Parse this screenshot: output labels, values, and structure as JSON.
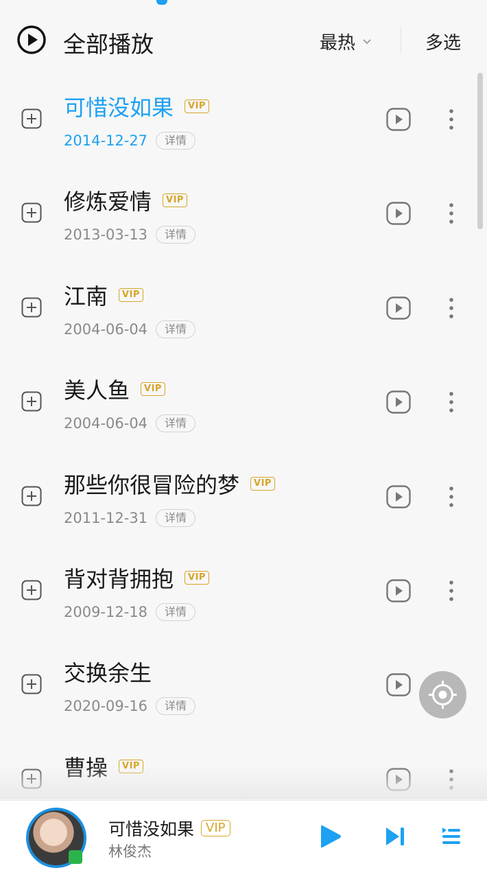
{
  "header": {
    "play_all_label": "全部播放",
    "sort_label": "最热",
    "multi_select_label": "多选"
  },
  "songs": [
    {
      "title": "可惜没如果",
      "vip": "VIP",
      "date": "2014-12-27",
      "detail": "详情",
      "active": true
    },
    {
      "title": "修炼爱情",
      "vip": "VIP",
      "date": "2013-03-13",
      "detail": "详情"
    },
    {
      "title": "江南",
      "vip": "VIP",
      "date": "2004-06-04",
      "detail": "详情"
    },
    {
      "title": "美人鱼",
      "vip": "VIP",
      "date": "2004-06-04",
      "detail": "详情"
    },
    {
      "title": "那些你很冒险的梦",
      "vip": "VIP",
      "date": "2011-12-31",
      "detail": "详情"
    },
    {
      "title": "背对背拥抱",
      "vip": "VIP",
      "date": "2009-12-18",
      "detail": "详情"
    },
    {
      "title": "交换余生",
      "vip": "",
      "date": "2020-09-16",
      "detail": "详情"
    },
    {
      "title": "曹操",
      "vip": "VIP",
      "date": "",
      "detail": ""
    }
  ],
  "player": {
    "title": "可惜没如果",
    "vip": "VIP",
    "artist": "林俊杰"
  },
  "colors": {
    "accent": "#1da1f2",
    "vip": "#d6a52a",
    "background": "#f7f7f7"
  },
  "icons": {
    "play_all": "play-circle-icon",
    "sort": "chevron-down-icon",
    "add": "add-square-icon",
    "row_play": "play-square-icon",
    "more": "more-vertical-icon",
    "locate": "locate-icon",
    "play": "play-icon",
    "next": "skip-next-icon",
    "playlist": "playlist-icon"
  }
}
